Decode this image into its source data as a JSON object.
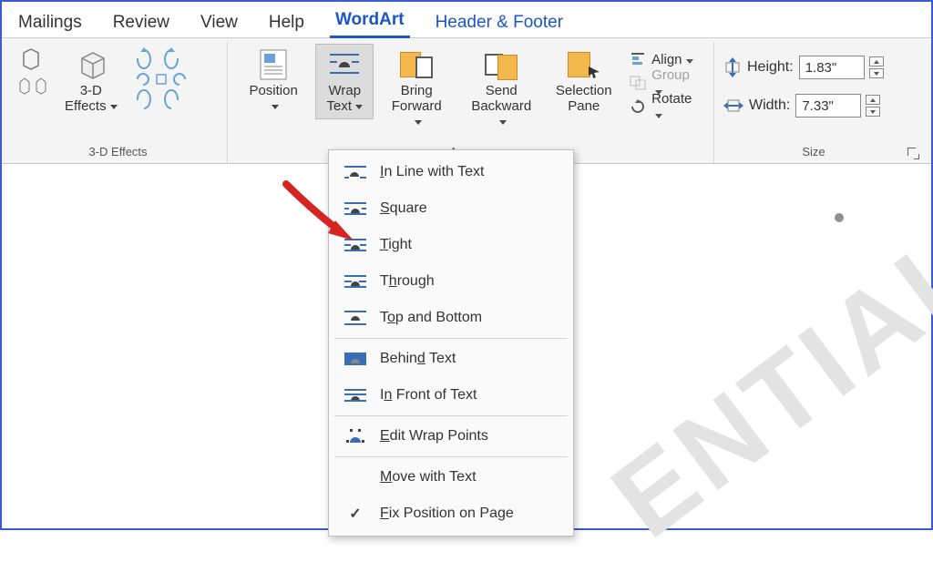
{
  "tabs": {
    "mailings": "Mailings",
    "review": "Review",
    "view": "View",
    "help": "Help",
    "wordart": "WordArt",
    "header_footer": "Header & Footer"
  },
  "ribbon": {
    "group_3d_effects": {
      "label": "3-D Effects",
      "button_3d_effects": "3-D\nEffects"
    },
    "group_arrange": {
      "label": "Arrange",
      "position": "Position",
      "wrap_text": "Wrap\nText",
      "bring_forward": "Bring\nForward",
      "send_backward": "Send\nBackward",
      "selection_pane": "Selection\nPane",
      "align": "Align",
      "group": "Group",
      "rotate": "Rotate"
    },
    "group_size": {
      "label": "Size",
      "height_label": "Height:",
      "width_label": "Width:",
      "height_value": "1.83\"",
      "width_value": "7.33\""
    }
  },
  "wrap_menu": {
    "in_line": "In Line with Text",
    "square": "Square",
    "tight": "Tight",
    "through": "Through",
    "top_bottom": "Top and Bottom",
    "behind": "Behind Text",
    "in_front": "In Front of Text",
    "edit_points": "Edit Wrap Points",
    "move_with_text": "Move with Text",
    "fix_position": "Fix Position on Page"
  },
  "watermark_text": "ENTIAL"
}
